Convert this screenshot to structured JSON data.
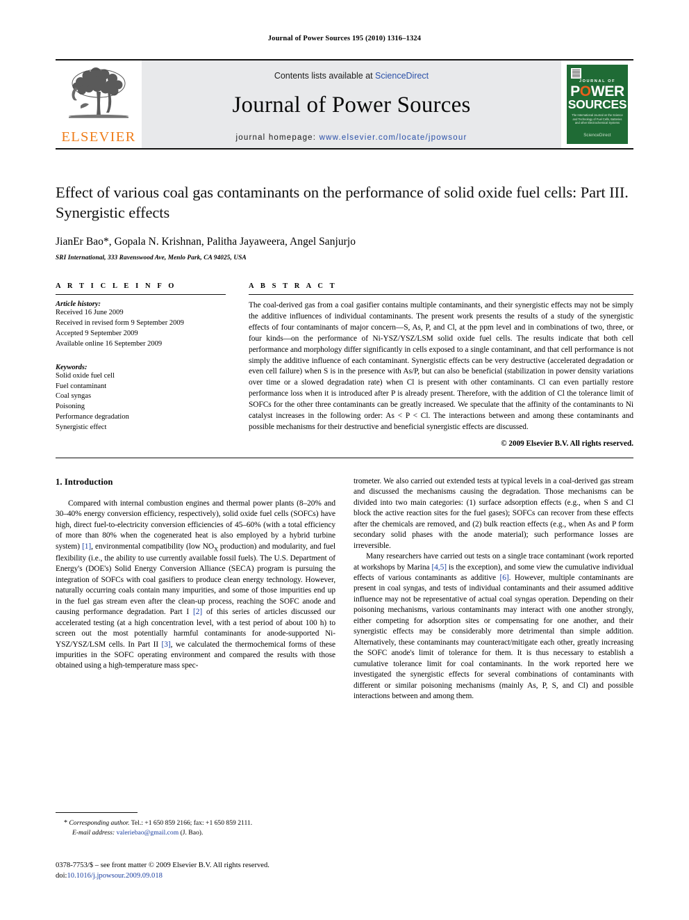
{
  "running_head": "Journal of Power Sources 195 (2010) 1316–1324",
  "masthead": {
    "publisher_name": "ELSEVIER",
    "contents_prefix": "Contents lists available at ",
    "contents_link": "ScienceDirect",
    "journal_title": "Journal of Power Sources",
    "homepage_label": "journal homepage:",
    "homepage_url": "www.elsevier.com/locate/jpowsour",
    "cover": {
      "kicker": "JOURNAL OF",
      "word1_a": "P",
      "word1_o": "O",
      "word1_b": "WER",
      "word2": "SOURCES",
      "subtitle": "The International Journal on the Science and Technology of Fuel Cells, Batteries and other Electrochemical Systems",
      "footer": "ScienceDirect"
    },
    "link_color": "#2b50a8",
    "band_color": "#e8e9eb",
    "brand_orange": "#ef7d1a",
    "cover_green": "#1f6b35"
  },
  "article": {
    "title": "Effect of various coal gas contaminants on the performance of solid oxide fuel cells: Part III. Synergistic effects",
    "authors": "JianEr Bao*, Gopala N. Krishnan, Palitha Jayaweera, Angel Sanjurjo",
    "affiliation": "SRI International, 333 Ravenswood Ave, Menlo Park, CA 94025, USA"
  },
  "article_info": {
    "heading": "A R T I C L E    I N F O",
    "history_label": "Article history:",
    "history": [
      "Received 16 June 2009",
      "Received in revised form 9 September 2009",
      "Accepted 9 September 2009",
      "Available online 16 September 2009"
    ],
    "keywords_label": "Keywords:",
    "keywords": [
      "Solid oxide fuel cell",
      "Fuel contaminant",
      "Coal syngas",
      "Poisoning",
      "Performance degradation",
      "Synergistic effect"
    ]
  },
  "abstract": {
    "heading": "A B S T R A C T",
    "text": "The coal-derived gas from a coal gasifier contains multiple contaminants, and their synergistic effects may not be simply the additive influences of individual contaminants. The present work presents the results of a study of the synergistic effects of four contaminants of major concern—S, As, P, and Cl, at the ppm level and in combinations of two, three, or four kinds—on the performance of Ni-YSZ/YSZ/LSM solid oxide fuel cells. The results indicate that both cell performance and morphology differ significantly in cells exposed to a single contaminant, and that cell performance is not simply the additive influence of each contaminant. Synergistic effects can be very destructive (accelerated degradation or even cell failure) when S is in the presence with As/P, but can also be beneficial (stabilization in power density variations over time or a slowed degradation rate) when Cl is present with other contaminants. Cl can even partially restore performance loss when it is introduced after P is already present. Therefore, with the addition of Cl the tolerance limit of SOFCs for the other three contaminants can be greatly increased. We speculate that the affinity of the contaminants to Ni catalyst increases in the following order: As < P < Cl. The interactions between and among these contaminants and possible mechanisms for their destructive and beneficial synergistic effects are discussed.",
    "copyright": "© 2009 Elsevier B.V. All rights reserved."
  },
  "introduction": {
    "heading": "1. Introduction",
    "left_paragraph_part1": "Compared with internal combustion engines and thermal power plants (8–20% and 30–40% energy conversion efficiency, respectively), solid oxide fuel cells (SOFCs) have high, direct fuel-to-electricity conversion efficiencies of 45–60% (with a total efficiency of more than 80% when the cogenerated heat is also employed by a hybrid turbine system) ",
    "ref1": "[1]",
    "left_paragraph_part2": ", environmental compatibility (low NO",
    "nox_sub": "X",
    "left_paragraph_part3": " production) and modularity, and fuel flexibility (i.e., the ability to use currently available fossil fuels). The U.S. Department of Energy's (DOE's) Solid Energy Conversion Alliance (SECA) program is pursuing the integration of SOFCs with coal gasifiers to produce clean energy technology. However, naturally occurring coals contain many impurities, and some of those impurities end up in the fuel gas stream even after the clean-up process, reaching the SOFC anode and causing performance degradation. Part I ",
    "ref2": "[2]",
    "left_paragraph_part4": " of this series of articles discussed our accelerated testing (at a high concentration level, with a test period of about 100 h) to screen out the most potentially harmful contaminants for anode-supported Ni-YSZ/YSZ/LSM cells. In Part II ",
    "ref3": "[3]",
    "left_paragraph_part5": ", we calculated the thermochemical forms of these impurities in the SOFC operating environment and compared the results with those obtained using a high-temperature mass spec-",
    "right_paragraph1": "trometer. We also carried out extended tests at typical levels in a coal-derived gas stream and discussed the mechanisms causing the degradation. Those mechanisms can be divided into two main categories: (1) surface adsorption effects (e.g., when S and Cl block the active reaction sites for the fuel gases); SOFCs can recover from these effects after the chemicals are removed, and (2) bulk reaction effects (e.g., when As and P form secondary solid phases with the anode material); such performance losses are irreversible.",
    "right_paragraph2_part1": "Many researchers have carried out tests on a single trace contaminant (work reported at workshops by Marina ",
    "ref45": "[4,5]",
    "right_paragraph2_part2": " is the exception), and some view the cumulative individual effects of various contaminants as additive ",
    "ref6": "[6]",
    "right_paragraph2_part3": ". However, multiple contaminants are present in coal syngas, and tests of individual contaminants and their assumed additive influence may not be representative of actual coal syngas operation. Depending on their poisoning mechanisms, various contaminants may interact with one another strongly, either competing for adsorption sites or compensating for one another, and their synergistic effects may be considerably more detrimental than simple addition. Alternatively, these contaminants may counteract/mitigate each other, greatly increasing the SOFC anode's limit of tolerance for them. It is thus necessary to establish a cumulative tolerance limit for coal contaminants. In the work reported here we investigated the synergistic effects for several combinations of contaminants with different or similar poisoning mechanisms (mainly As, P, S, and Cl) and possible interactions between and among them."
  },
  "footnotes": {
    "corresponding_star": "*",
    "corresponding_label": "Corresponding author.",
    "corresponding_text": " Tel.: +1 650 859 2166; fax: +1 650 859 2111.",
    "email_label": "E-mail address:",
    "email": "valeriebao@gmail.com",
    "email_suffix": " (J. Bao)."
  },
  "imprint": {
    "issn_line": "0378-7753/$ – see front matter © 2009 Elsevier B.V. All rights reserved.",
    "doi_label": "doi:",
    "doi": "10.1016/j.jpowsour.2009.09.018"
  }
}
